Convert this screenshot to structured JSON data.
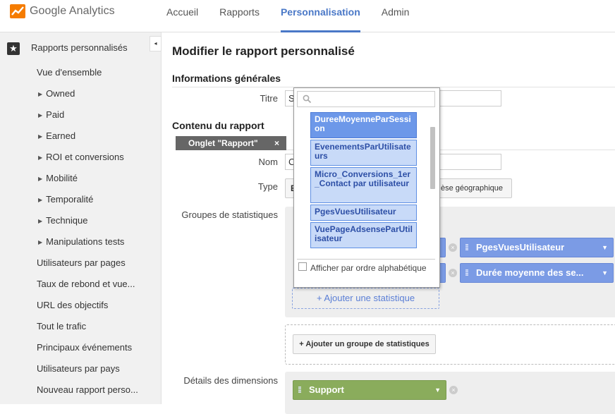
{
  "app": {
    "name": "Google Analytics"
  },
  "nav": [
    "Accueil",
    "Rapports",
    "Personnalisation",
    "Admin"
  ],
  "nav_active": "Personnalisation",
  "sidebar": {
    "header": "Rapports personnalisés",
    "collapse_icon": "◂",
    "items": [
      {
        "label": "Vue d'ensemble",
        "expandable": false
      },
      {
        "label": "Owned",
        "expandable": true
      },
      {
        "label": "Paid",
        "expandable": true
      },
      {
        "label": "Earned",
        "expandable": true
      },
      {
        "label": "ROI et conversions",
        "expandable": true
      },
      {
        "label": "Mobilité",
        "expandable": true
      },
      {
        "label": "Temporalité",
        "expandable": true
      },
      {
        "label": "Technique",
        "expandable": true
      },
      {
        "label": "Manipulations tests",
        "expandable": true
      },
      {
        "label": "Utilisateurs par pages",
        "expandable": false
      },
      {
        "label": "Taux de rebond et vue...",
        "expandable": false
      },
      {
        "label": "URL des objectifs",
        "expandable": false
      },
      {
        "label": "Tout le trafic",
        "expandable": false
      },
      {
        "label": "Principaux événements",
        "expandable": false
      },
      {
        "label": "Utilisateurs par pays",
        "expandable": false
      },
      {
        "label": "Nouveau rapport perso...",
        "expandable": false
      }
    ]
  },
  "main": {
    "title": "Modifier le rapport personnalisé",
    "general_info": "Informations générales",
    "title_label": "Titre",
    "title_value": "S",
    "content_title": "Contenu du rapport",
    "tab_chip": "Onglet \"Rapport\"",
    "tab_chip_close": "×",
    "name_label": "Nom",
    "name_value": "C",
    "type_label": "Type",
    "type_value_first": "E",
    "type_button_geo": "èse géographique",
    "stat_groups_label": "Groupes de statistiques",
    "metric_pills": [
      "PgesVuesUtilisateur",
      "Durée moyenne des se..."
    ],
    "add_stat": "+ Ajouter une statistique",
    "add_group": "+ Ajouter un groupe de statistiques",
    "dimension_details_label": "Détails des dimensions",
    "dimension_pill": "Support"
  },
  "dropdown": {
    "search_placeholder": "",
    "options": [
      {
        "label": "DureeMoyenneParSession",
        "active": true
      },
      {
        "label": "EvenementsParUtilisateurs",
        "active": false
      },
      {
        "label": "Micro_Conversions_1er_Contact par utilisateur",
        "active": false
      },
      {
        "label": "PgesVuesUtilisateur",
        "active": false
      },
      {
        "label": "VuePageAdsenseParUtilisateur",
        "active": false
      }
    ],
    "sort_label": "Afficher par ordre alphabétique",
    "sort_checked": false
  },
  "colors": {
    "accent": "#4a78c7",
    "metric_pill": "#7b9be5",
    "dimension_pill": "#8aac5c",
    "option_active": "#6d98e9",
    "option": "#c8daf8"
  }
}
